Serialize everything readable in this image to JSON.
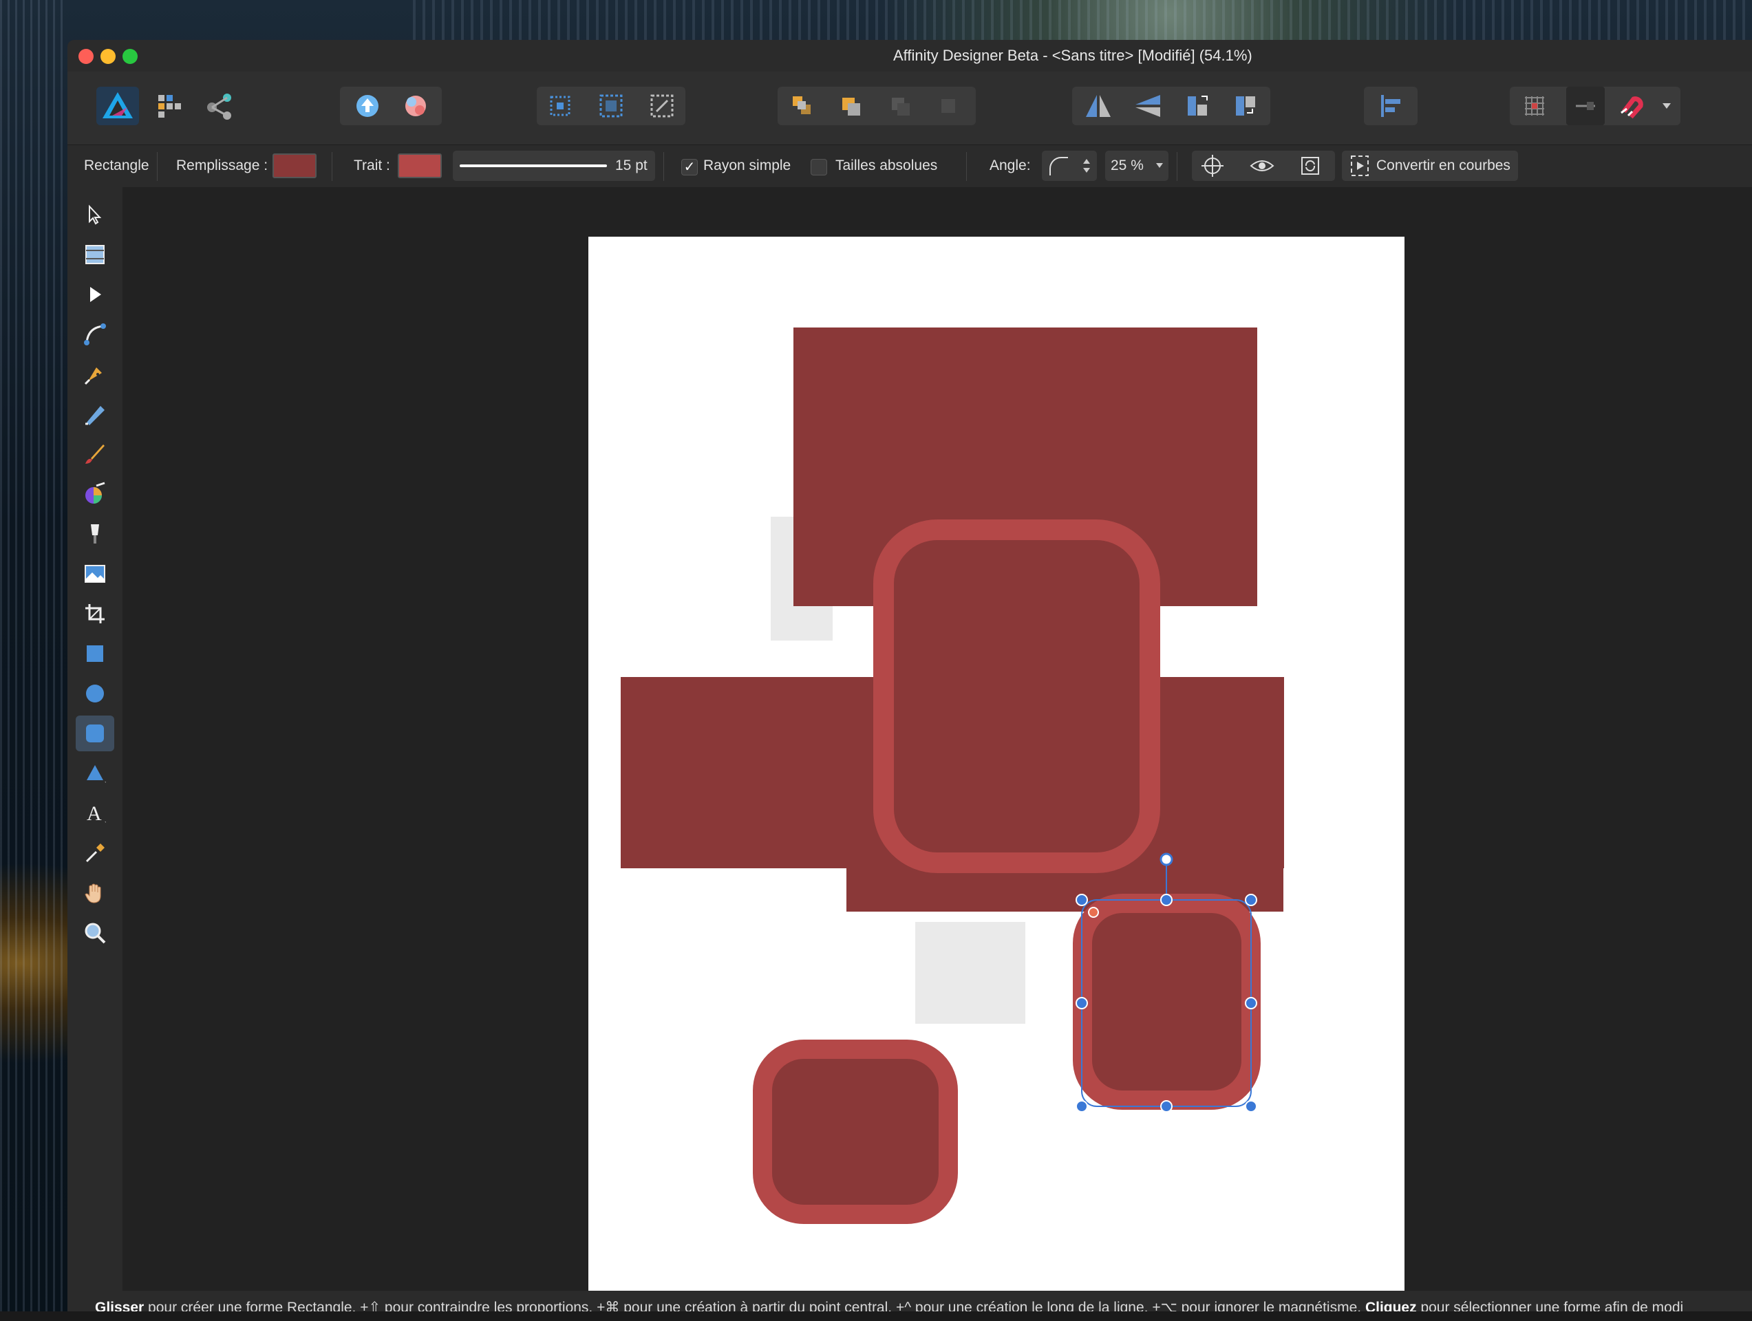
{
  "window": {
    "title": "Affinity Designer Beta - <Sans titre> [Modifié] (54.1%)"
  },
  "context_bar": {
    "shape_label": "Rectangle",
    "fill_label": "Remplissage :",
    "fill_color": "#8a3838",
    "stroke_label": "Trait :",
    "stroke_color": "#b44848",
    "stroke_width": "15 pt",
    "single_radius_label": "Rayon simple",
    "absolute_sizes_label": "Tailles absolues",
    "angle_label": "Angle:",
    "radius_value": "25 %",
    "convert_label": "Convertir en courbes"
  },
  "status": {
    "drag_bold": "Glisser",
    "drag_text": " pour créer une forme Rectangle, +",
    "shift_symbol": "⇧",
    "constrain_text": " pour contraindre les proportions, +",
    "cmd_symbol": "⌘",
    "center_text": " pour une création à partir du point central, +",
    "ctrl_symbol": "^",
    "line_text": " pour une création le long de la ligne, +",
    "alt_symbol": "⌥",
    "snap_text": " pour ignorer le magnétisme. ",
    "click_bold": "Cliquez",
    "select_text": " pour sélectionner une forme afin de modi"
  },
  "colors": {
    "fill": "#8a3838",
    "stroke": "#b44848",
    "selection": "#3a78d6",
    "accent_tool": "#4a90d9"
  },
  "icons": {
    "tools": [
      "move-tool-icon",
      "artboard-tool-icon",
      "node-tool-icon",
      "corner-tool-icon",
      "pen-tool-icon",
      "pencil-tool-icon",
      "brush-tool-icon",
      "fill-tool-icon",
      "transparency-tool-icon",
      "place-image-icon",
      "crop-tool-icon",
      "rectangle-tool-icon",
      "ellipse-tool-icon",
      "rounded-rectangle-tool-icon",
      "triangle-tool-icon",
      "text-tool-icon",
      "color-picker-icon",
      "hand-tool-icon",
      "zoom-tool-icon"
    ]
  }
}
